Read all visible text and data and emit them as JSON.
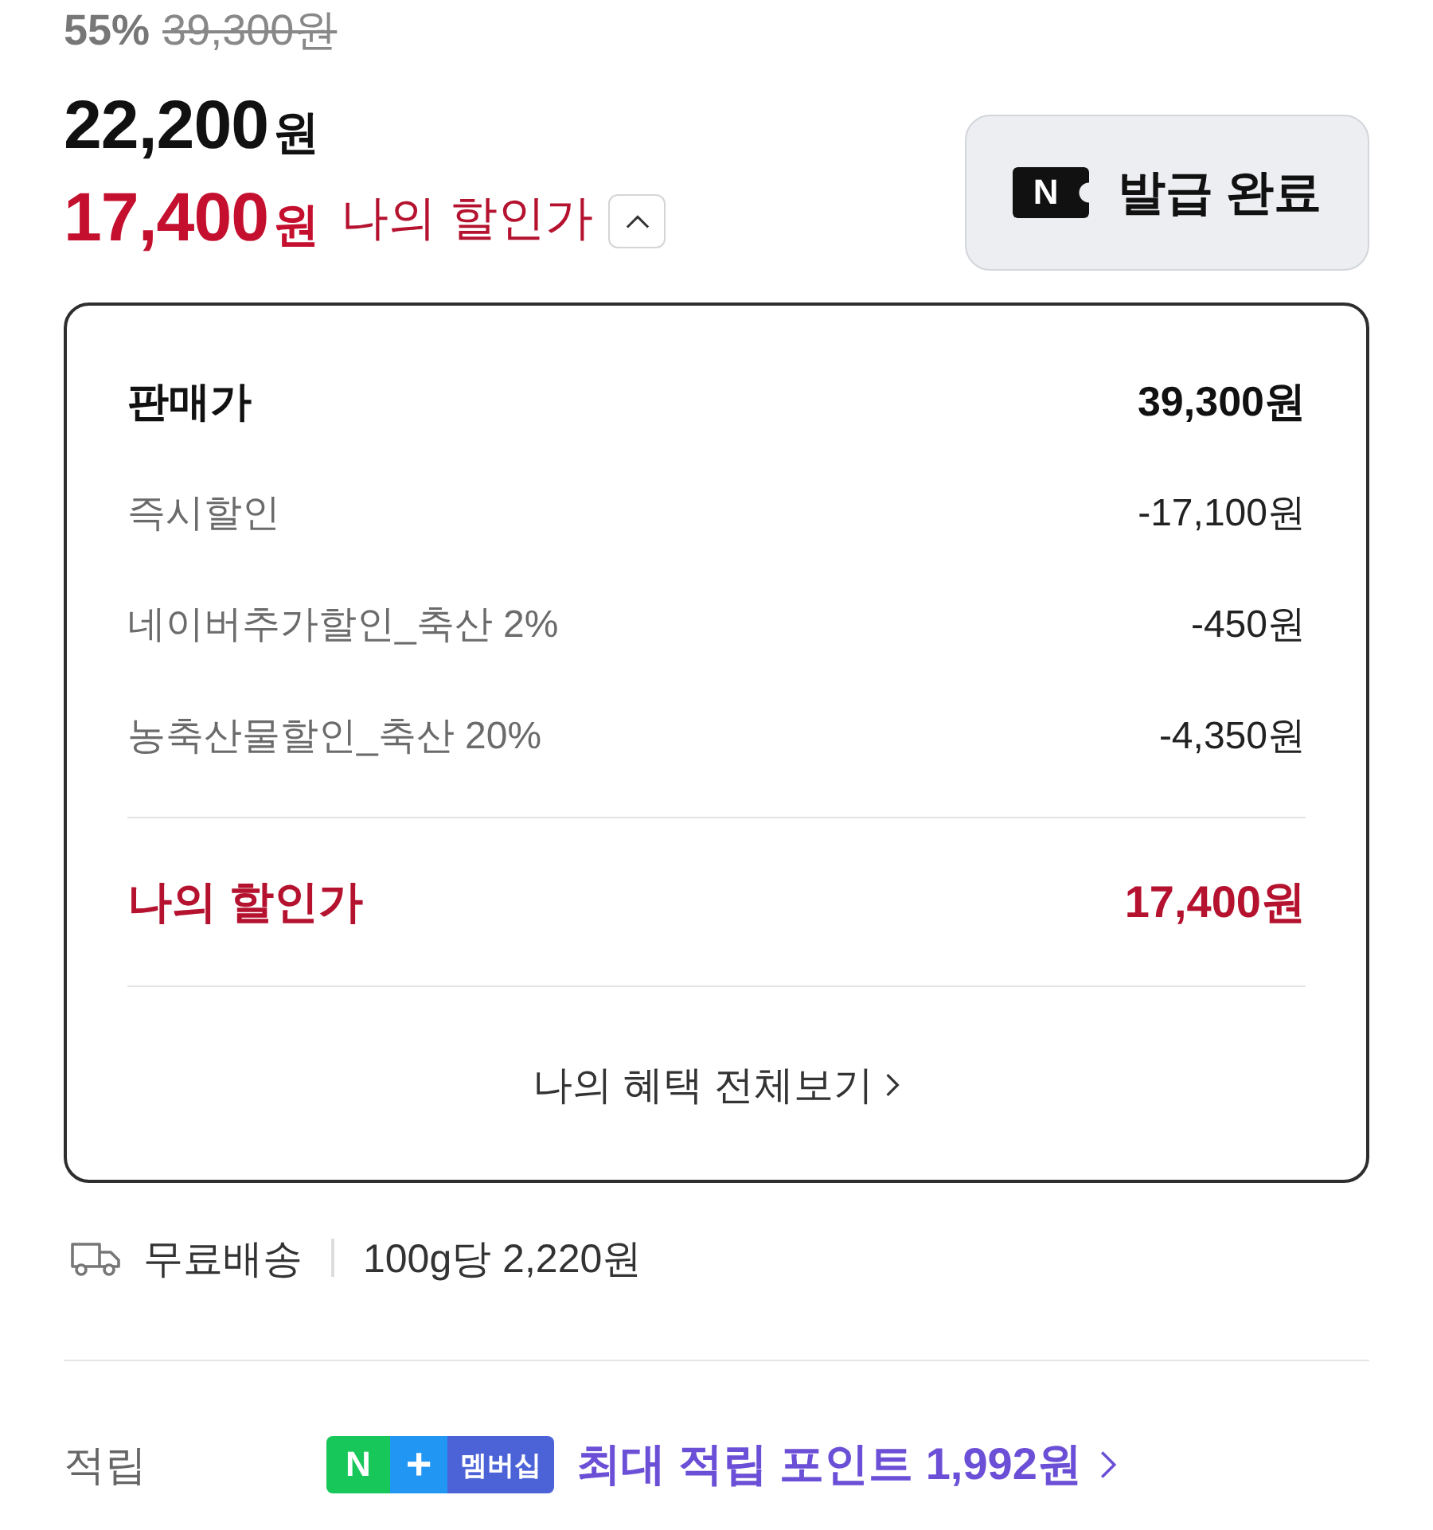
{
  "price": {
    "discount_rate": "55%",
    "original_price": "39,300원",
    "sale_amount": "22,200",
    "sale_unit": "원",
    "my_amount": "17,400",
    "my_unit": "원",
    "my_label": "나의 할인가",
    "breakdown_expanded": true
  },
  "coupon_button": {
    "icon_letter": "N",
    "label": "발급 완료"
  },
  "breakdown": {
    "rows": [
      {
        "kind": "base",
        "label": "판매가",
        "amount": "39,300원"
      },
      {
        "kind": "discount",
        "label": "즉시할인",
        "amount": "-17,100원"
      },
      {
        "kind": "discount",
        "label": "네이버추가할인_축산 2%",
        "amount": "-450원"
      },
      {
        "kind": "discount",
        "label": "농축산물할인_축산 20%",
        "amount": "-4,350원"
      }
    ],
    "total": {
      "label": "나의 할인가",
      "amount": "17,400원"
    },
    "link": "나의 혜택 전체보기"
  },
  "shipping": {
    "label": "무료배송",
    "unit_price": "100g당 2,220원"
  },
  "points": {
    "label": "적립",
    "badge": {
      "letter": "N",
      "plus": "+",
      "text": "멤버십"
    },
    "text": "최대 적립 포인트 1,992원"
  }
}
